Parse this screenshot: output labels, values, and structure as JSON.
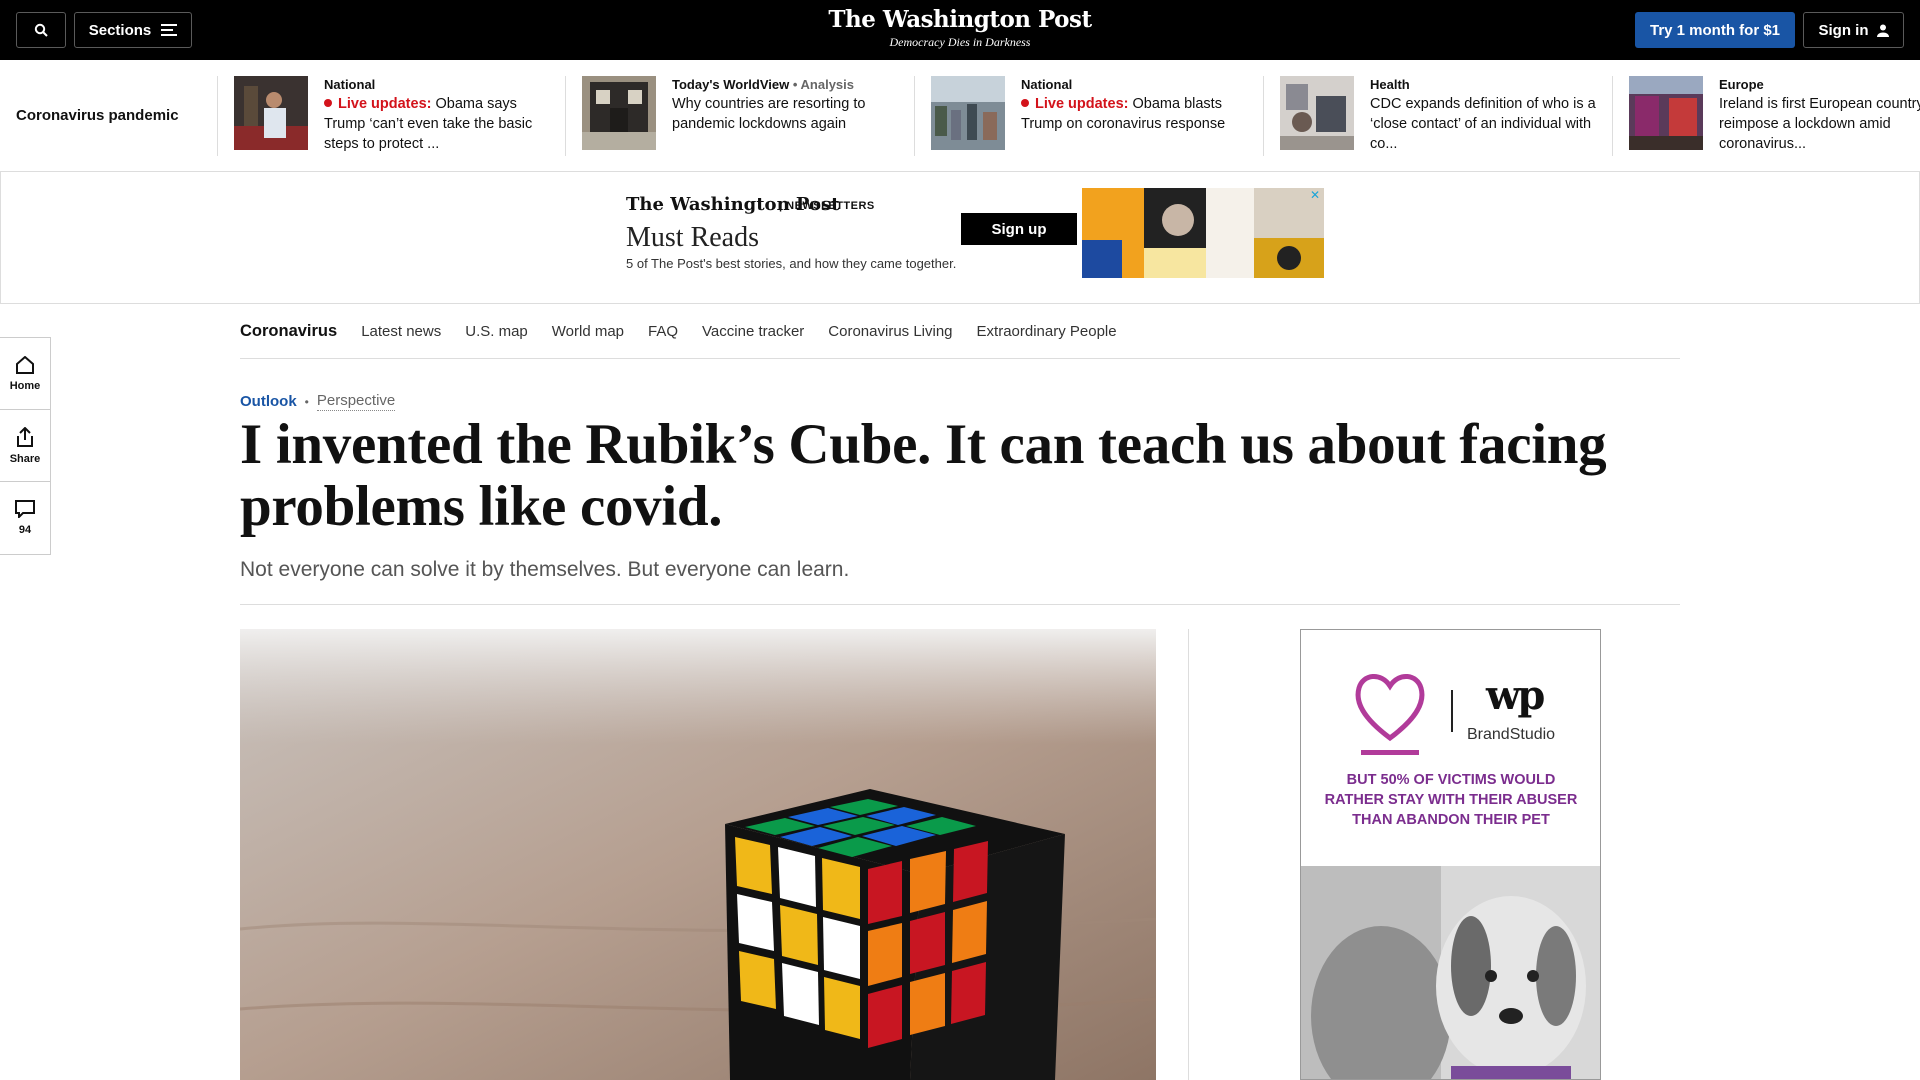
{
  "topbar": {
    "sections_label": "Sections",
    "logo": "The Washington Post",
    "tagline": "Democracy Dies in Darkness",
    "subscribe_label": "Try 1 month for $1",
    "signin_label": "Sign in"
  },
  "ticker": {
    "label": "Coronavirus pandemic",
    "items": [
      {
        "kicker": "National",
        "live": "Live updates:",
        "text": "Obama says Trump ‘can’t even take the basic steps to protect ..."
      },
      {
        "kicker": "Today's WorldView",
        "analysis": " • Analysis",
        "text": "Why countries are resorting to pandemic lockdowns again"
      },
      {
        "kicker": "National",
        "live": "Live updates:",
        "text": "Obama blasts Trump on coronavirus response"
      },
      {
        "kicker": "Health",
        "text": "CDC expands definition of who is a ‘close contact’ of an individual with co..."
      },
      {
        "kicker": "Europe",
        "text": "Ireland is first European country to reimpose a lockdown amid coronavirus..."
      }
    ]
  },
  "ad_banner": {
    "logo": "The Washington Post",
    "newsletters": "| NEWSLETTERS",
    "title": "Must Reads",
    "subtitle": "5 of The Post's best stories, and how they came together.",
    "cta": "Sign up"
  },
  "subnav": {
    "brand": "Coronavirus",
    "links": [
      "Latest news",
      "U.S. map",
      "World map",
      "FAQ",
      "Vaccine tracker",
      "Coronavirus Living",
      "Extraordinary People"
    ]
  },
  "rail": {
    "home": "Home",
    "share": "Share",
    "comments": "94"
  },
  "article": {
    "section": "Outlook",
    "separator": "•",
    "label": "Perspective",
    "headline": "I invented the Rubik’s Cube. It can teach us about facing problems like covid.",
    "dek": "Not everyone can solve it by themselves. But everyone can learn."
  },
  "side_ad": {
    "brandstudio": "BrandStudio",
    "wp": "wp",
    "headline": "BUT 50% OF VICTIMS WOULD RATHER STAY WITH THEIR ABUSER THAN ABANDON THEIR PET"
  },
  "colors": {
    "accent_blue": "#1955a5",
    "live_red": "#d3131b",
    "ad_purple": "#7b2d8e"
  }
}
